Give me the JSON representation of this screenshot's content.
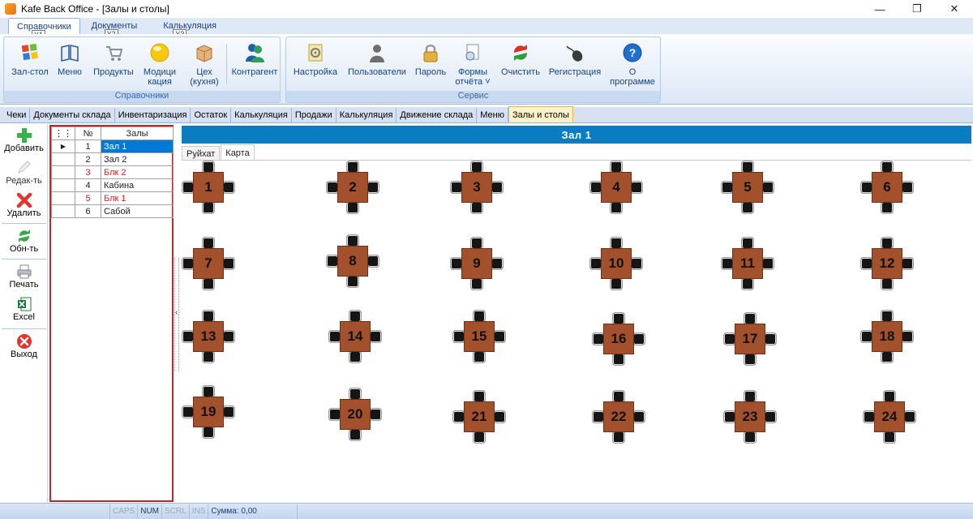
{
  "window": {
    "title": "Kafe Back Office - [Залы и столы]",
    "controls": [
      "—",
      "❐",
      "✕"
    ]
  },
  "ribbon_tabs": [
    {
      "label": "Справочники",
      "keytip": "Y1",
      "active": true
    },
    {
      "label": "Документы",
      "keytip": "Y2",
      "active": false
    },
    {
      "label": "Калькуляция",
      "keytip": "Y3",
      "active": false
    }
  ],
  "mdi_controls": [
    "—",
    "▭",
    "✕"
  ],
  "ribbon_groups": {
    "spravochniki": {
      "caption": "Справочники",
      "buttons": [
        {
          "label": "Зал-стол",
          "icon": "windows-flag-icon"
        },
        {
          "label": "Меню",
          "icon": "book-icon"
        },
        {
          "label": "Продукты",
          "icon": "cart-icon"
        },
        {
          "label": "Модици\nкация",
          "icon": "circle-icon"
        },
        {
          "label": "Цех\n(кухня)",
          "icon": "box-icon"
        },
        {
          "label": "Контрагент",
          "icon": "users-icon"
        }
      ]
    },
    "servis": {
      "caption": "Сервис",
      "buttons": [
        {
          "label": "Настройка",
          "icon": "settings-icon"
        },
        {
          "label": "Пользователи",
          "icon": "user-icon"
        },
        {
          "label": "Пароль",
          "icon": "lock-icon"
        },
        {
          "label": "Формы\nотчёта ˅",
          "icon": "report-icon"
        },
        {
          "label": "Очистить",
          "icon": "refresh-icon"
        },
        {
          "label": "Регистрация",
          "icon": "mouse-icon"
        },
        {
          "label": "О\nпрограмме",
          "icon": "help-icon"
        }
      ]
    }
  },
  "doc_tabs": [
    {
      "label": "Чеки",
      "active": false
    },
    {
      "label": "Документы склада",
      "active": false
    },
    {
      "label": "Инвентаризация",
      "active": false
    },
    {
      "label": "Остаток",
      "active": false
    },
    {
      "label": "Калькуляция",
      "active": false
    },
    {
      "label": "Продажи",
      "active": false
    },
    {
      "label": "Калькуляция",
      "active": false
    },
    {
      "label": "Движение склада",
      "active": false
    },
    {
      "label": "Меню",
      "active": false
    },
    {
      "label": "Залы и столы",
      "active": true
    }
  ],
  "sidebar": [
    {
      "label": "Добавить",
      "icon": "plus-icon"
    },
    {
      "label": "Редак-ть",
      "icon": "edit-icon"
    },
    {
      "label": "Удалить",
      "icon": "delete-icon"
    },
    {
      "label": "Обн-ть",
      "icon": "refresh-icon"
    },
    {
      "label": "Печать",
      "icon": "printer-icon"
    },
    {
      "label": "Excel",
      "icon": "excel-icon"
    },
    {
      "label": "Выход",
      "icon": "exit-icon"
    }
  ],
  "halls_grid": {
    "columns": [
      "№",
      "Залы"
    ],
    "rows": [
      {
        "num": "1",
        "name": "Зал 1",
        "selected": true,
        "red": false
      },
      {
        "num": "2",
        "name": "Зал 2",
        "selected": false,
        "red": false
      },
      {
        "num": "3",
        "name": "Блк 2",
        "selected": false,
        "red": true
      },
      {
        "num": "4",
        "name": "Кабина",
        "selected": false,
        "red": false
      },
      {
        "num": "5",
        "name": "Блк 1",
        "selected": false,
        "red": true
      },
      {
        "num": "6",
        "name": "Сабой",
        "selected": false,
        "red": false
      }
    ]
  },
  "map": {
    "header": "Зал 1",
    "tabs": [
      {
        "label": "Руйхат",
        "active": false
      },
      {
        "label": "Карта",
        "active": true
      }
    ],
    "tables": [
      "1",
      "2",
      "3",
      "4",
      "5",
      "6",
      "7",
      "8",
      "9",
      "10",
      "11",
      "12",
      "13",
      "14",
      "15",
      "16",
      "17",
      "18",
      "19",
      "20",
      "21",
      "22",
      "23",
      "24"
    ]
  },
  "statusbar": {
    "caps": "CAPS",
    "num": "NUM",
    "scrl": "SCRL",
    "ins": "INS",
    "sum": "Сумма: 0,00"
  },
  "colors": {
    "accent": "#0a7dc2",
    "table": "#a3502c",
    "selection": "#0078d7",
    "highlight_tab": "#fdf1c8"
  }
}
